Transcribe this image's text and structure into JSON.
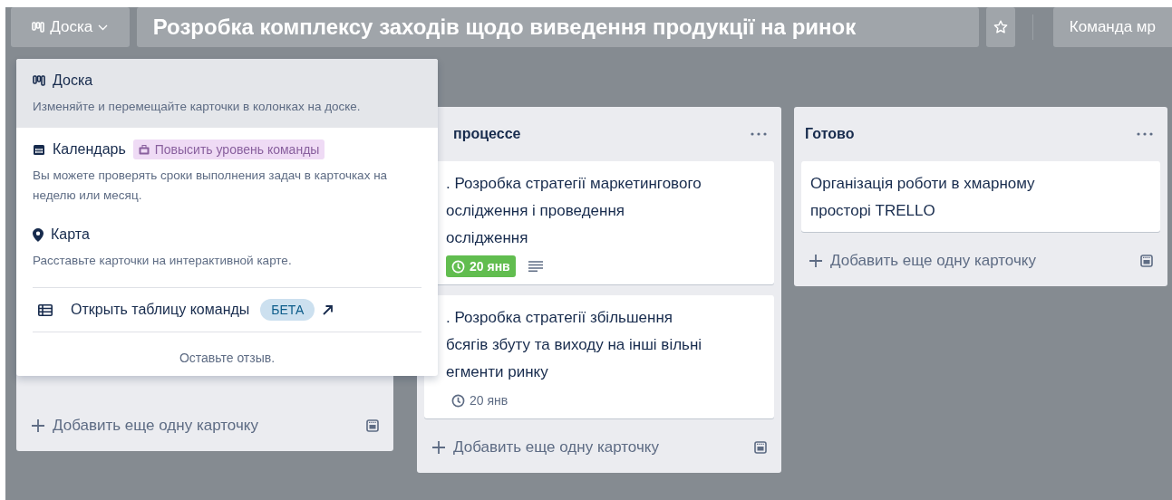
{
  "header": {
    "view_switcher": "Доска",
    "board_title": "Розробка комплексу заходів щодо виведення продукції на ринок",
    "starred": false,
    "team_button": "Команда мр"
  },
  "view_menu": {
    "views": [
      {
        "kind": "board",
        "label": "Доска",
        "description": "Изменяйте и перемещайте карточки в колонках на доске.",
        "selected": true
      },
      {
        "kind": "calendar",
        "label": "Календарь",
        "badge": "Повысить уровень команды",
        "description": "Вы можете проверять сроки выполнения задач в карточках на неделю или месяц.",
        "selected": false
      },
      {
        "kind": "map",
        "label": "Карта",
        "description": "Расставьте карточки на интерактивной карте.",
        "selected": false
      }
    ],
    "table_link": {
      "label": "Открыть таблицу команды",
      "badge": "БЕТА"
    },
    "feedback": "Оставьте отзыв."
  },
  "lists": [
    {
      "kind": "covered",
      "add_card": "Добавить еще одну карточку"
    },
    {
      "kind": "partial",
      "title": "процессе",
      "cards": [
        {
          "title_lines": [
            ". Розробка стратегії маркетингового",
            "ослідження і проведення",
            "ослідження"
          ],
          "due": "20 янв",
          "due_complete": true,
          "has_description": true
        },
        {
          "title_lines": [
            ". Розробка стратегії збільшення",
            "бсягів збуту та виходу на інші вільні",
            "егменти ринку"
          ],
          "due": "20 янв",
          "due_complete": false,
          "has_description": false
        }
      ],
      "add_card": "Добавить еще одну карточку"
    },
    {
      "kind": "full",
      "title": "Готово",
      "cards": [
        {
          "title_lines": [
            "Організація роботи в хмарному",
            "просторі TRELLO"
          ],
          "has_description": false
        }
      ],
      "add_card": "Добавить еще одну карточку"
    }
  ]
}
